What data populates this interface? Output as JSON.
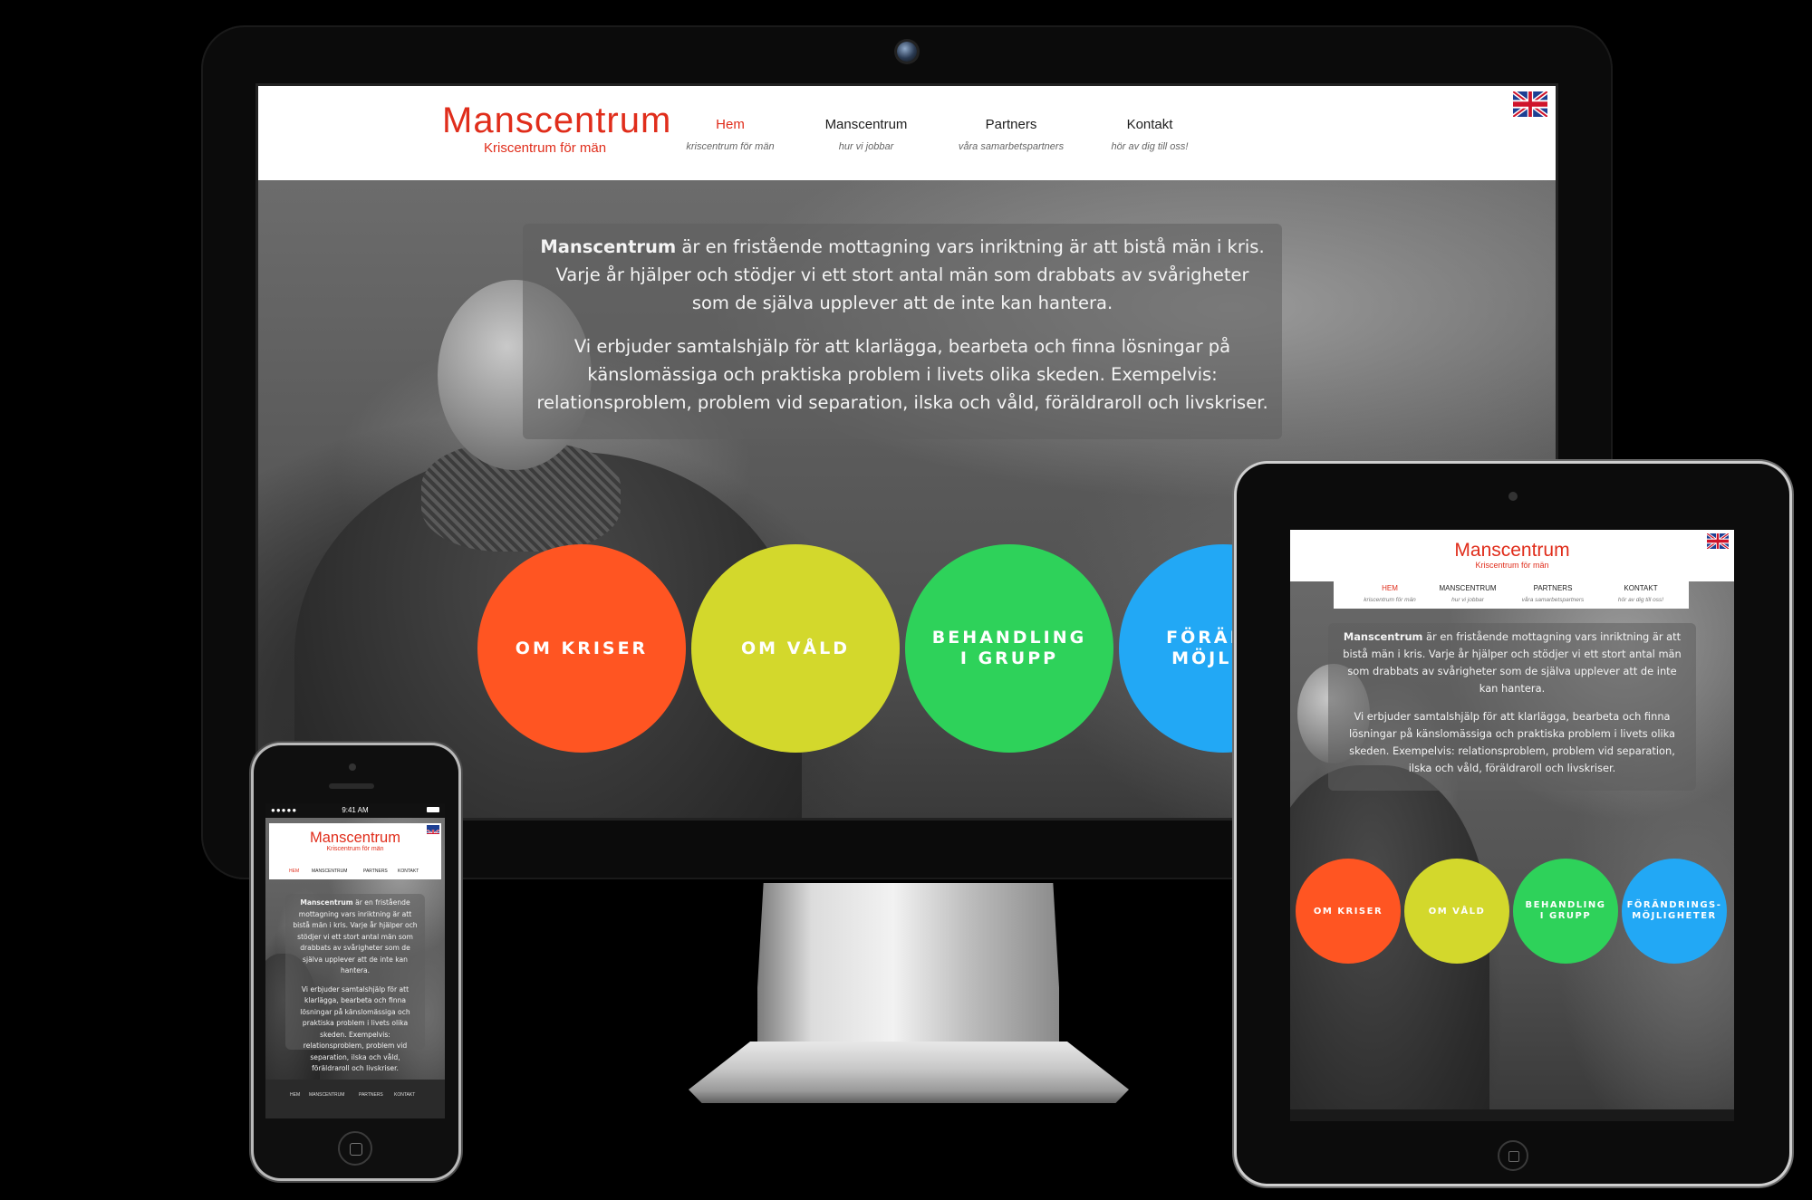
{
  "site": {
    "logo_title": "Manscentrum",
    "logo_subtitle": "Kriscentrum för män"
  },
  "nav": [
    {
      "label": "Hem",
      "sub": "kriscentrum för män",
      "active": true
    },
    {
      "label": "Manscentrum",
      "sub": "hur vi jobbar",
      "active": false
    },
    {
      "label": "Partners",
      "sub": "våra samarbetspartners",
      "active": false
    },
    {
      "label": "Kontakt",
      "sub": "hör av dig till oss!",
      "active": false
    }
  ],
  "nav_upper": [
    "HEM",
    "MANSCENTRUM",
    "PARTNERS",
    "KONTAKT"
  ],
  "intro": {
    "brand": "Manscentrum",
    "p1_rest": " är en fristående mottagning vars inriktning är att bistå män i kris. Varje år hjälper och stödjer vi ett stort antal män som drabbats av svårigheter som de själva upplever att de inte kan hantera.",
    "p2": "Vi erbjuder samtalshjälp för att klarlägga, bearbeta och finna lösningar på känslomässiga och praktiska problem i livets olika skeden. Exempelvis: relationsproblem, problem vid separation, ilska och våld, föräldraroll och livskriser."
  },
  "circles": [
    {
      "label": "OM KRISER",
      "color": "#ff5522"
    },
    {
      "label": "OM VÅLD",
      "color": "#d3d82c"
    },
    {
      "label": "BEHANDLING\nI GRUPP",
      "color": "#2ed25a"
    },
    {
      "label": "FÖRÄNDRINGS-\nMÖJLIGHETER",
      "color": "#22a8f5"
    }
  ],
  "monitor_circle4_partial": "FÖRÄNDR\nMÖJLIGH",
  "phone_status": {
    "time": "9:41 AM"
  },
  "phone_footer_nav": [
    "HEM",
    "MANSCENTRUM",
    "PARTNERS",
    "KONTAKT"
  ],
  "icons": {
    "flag": "uk-flag-icon",
    "camera": "camera-icon",
    "home": "home-button-icon"
  }
}
